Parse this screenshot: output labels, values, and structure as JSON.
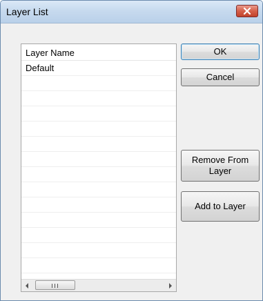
{
  "window": {
    "title": "Layer List"
  },
  "list": {
    "header": "Layer Name",
    "rows": [
      "Default",
      "",
      "",
      "",
      "",
      "",
      "",
      "",
      "",
      "",
      "",
      "",
      "",
      "",
      ""
    ],
    "scroll_thumb_position": 0
  },
  "buttons": {
    "ok": "OK",
    "cancel": "Cancel",
    "remove_from_layer": "Remove From Layer",
    "add_to_layer": "Add to Layer"
  },
  "colors": {
    "title_bar": "#c7daee",
    "close_button": "#d55f49",
    "dialog_bg": "#f0f0f0",
    "default_button_border": "#3c7fb1"
  }
}
